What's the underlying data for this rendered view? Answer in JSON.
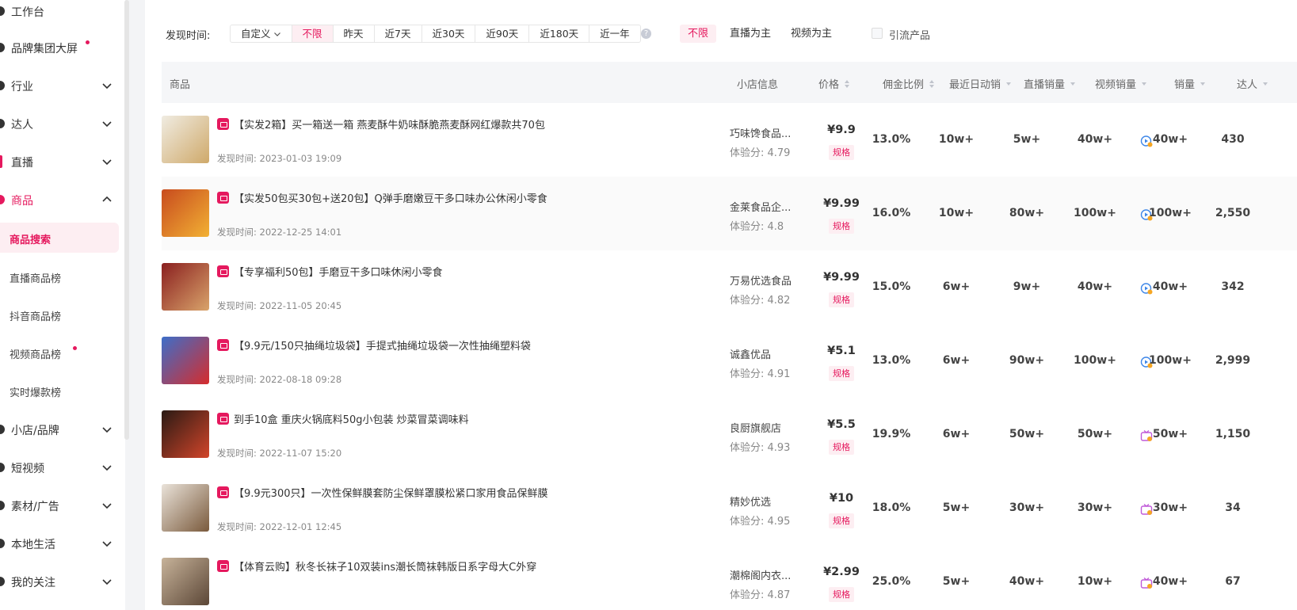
{
  "sidebar": {
    "items": [
      {
        "label": "工作台"
      },
      {
        "label": "品牌集团大屏"
      },
      {
        "label": "行业"
      },
      {
        "label": "达人"
      },
      {
        "label": "直播"
      },
      {
        "label": "商品"
      },
      {
        "label": "小店/品牌"
      },
      {
        "label": "短视频"
      },
      {
        "label": "素材/广告"
      },
      {
        "label": "本地生活"
      },
      {
        "label": "我的关注"
      }
    ],
    "sub_items": [
      {
        "label": "商品搜索"
      },
      {
        "label": "直播商品榜"
      },
      {
        "label": "抖音商品榜"
      },
      {
        "label": "视频商品榜"
      },
      {
        "label": "实时爆款榜"
      }
    ]
  },
  "filters": {
    "found_time_label": "发现时间:",
    "time_options": [
      "自定义",
      "不限",
      "昨天",
      "近7天",
      "近30天",
      "近90天",
      "近180天",
      "近一年"
    ],
    "help": "?",
    "mode_options": [
      "不限",
      "直播为主",
      "视频为主"
    ],
    "traffic_label": "引流产品"
  },
  "table": {
    "headers": {
      "product": "商品",
      "shop": "小店信息",
      "price": "价格",
      "commission": "佣金比例",
      "daily": "最近日动销",
      "live": "直播销量",
      "video": "视频销量",
      "sales": "销量",
      "influencer": "达人"
    },
    "found_prefix": "发现时间:",
    "spec_label": "规格",
    "rows": [
      {
        "title": "【实发2箱】买一箱送一箱 燕麦酥牛奶味酥脆燕麦酥网红爆款共70包",
        "found": "2023-01-03 19:09",
        "shop": "巧味馋食品...",
        "score": "体验分: 4.79",
        "price": "¥9.9",
        "commission": "13.0%",
        "daily": "10w+",
        "live": "5w+",
        "video": "40w+",
        "sales": "40w+",
        "sales_type": "video",
        "influencers": "430"
      },
      {
        "title": "【实发50包买30包+送20包】Q弹手磨嫩豆干多口味办公休闲小零食",
        "found": "2022-12-25 14:01",
        "shop": "金莱食品企...",
        "score": "体验分: 4.8",
        "price": "¥9.99",
        "commission": "16.0%",
        "daily": "10w+",
        "live": "80w+",
        "video": "100w+",
        "sales": "100w+",
        "sales_type": "video",
        "influencers": "2,550"
      },
      {
        "title": "【专享福利50包】手磨豆干多口味休闲小零食",
        "found": "2022-11-05 20:45",
        "shop": "万易优选食品",
        "score": "体验分: 4.82",
        "price": "¥9.99",
        "commission": "15.0%",
        "daily": "6w+",
        "live": "9w+",
        "video": "40w+",
        "sales": "40w+",
        "sales_type": "video",
        "influencers": "342"
      },
      {
        "title": "【9.9元/150只抽绳垃圾袋】手提式抽绳垃圾袋一次性抽绳塑料袋",
        "found": "2022-08-18 09:28",
        "shop": "诚鑫优品",
        "score": "体验分: 4.91",
        "price": "¥5.1",
        "commission": "13.0%",
        "daily": "6w+",
        "live": "90w+",
        "video": "100w+",
        "sales": "100w+",
        "sales_type": "video",
        "influencers": "2,999"
      },
      {
        "title": "到手10盒 重庆火锅底料50g小包装 炒菜冒菜调味料",
        "found": "2022-11-07 15:20",
        "shop": "良厨旗舰店",
        "score": "体验分: 4.93",
        "price": "¥5.5",
        "commission": "19.9%",
        "daily": "6w+",
        "live": "50w+",
        "video": "50w+",
        "sales": "50w+",
        "sales_type": "live",
        "influencers": "1,150"
      },
      {
        "title": "【9.9元300只】一次性保鲜膜套防尘保鲜罩膜松紧口家用食品保鲜膜",
        "found": "2022-12-01 12:45",
        "shop": "精妙优选",
        "score": "体验分: 4.95",
        "price": "¥10",
        "commission": "18.0%",
        "daily": "5w+",
        "live": "30w+",
        "video": "30w+",
        "sales": "30w+",
        "sales_type": "live",
        "influencers": "34"
      },
      {
        "title": "【体育云购】秋冬长袜子10双装ins潮长筒袜韩版日系字母大C外穿",
        "found": "",
        "shop": "潮棉阁内衣...",
        "score": "体验分: 4.87",
        "price": "¥2.99",
        "commission": "25.0%",
        "daily": "5w+",
        "live": "40w+",
        "video": "10w+",
        "sales": "40w+",
        "sales_type": "live",
        "influencers": "67"
      }
    ]
  },
  "colors": {
    "accent": "#e5195e",
    "accent_bg": "#fdeef2"
  }
}
